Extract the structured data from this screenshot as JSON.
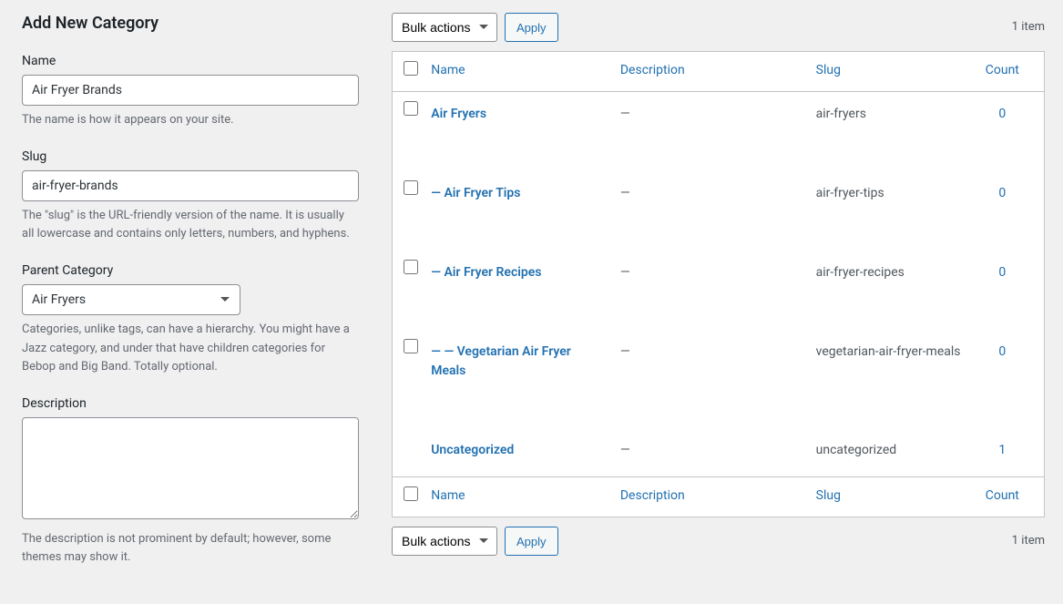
{
  "form": {
    "heading": "Add New Category",
    "name": {
      "label": "Name",
      "value": "Air Fryer Brands",
      "hint": "The name is how it appears on your site."
    },
    "slug": {
      "label": "Slug",
      "value": "air-fryer-brands",
      "hint": "The \"slug\" is the URL-friendly version of the name. It is usually all lowercase and contains only letters, numbers, and hyphens."
    },
    "parent": {
      "label": "Parent Category",
      "selected": "Air Fryers",
      "hint": "Categories, unlike tags, can have a hierarchy. You might have a Jazz category, and under that have children categories for Bebop and Big Band. Totally optional."
    },
    "description": {
      "label": "Description",
      "value": "",
      "hint": "The description is not prominent by default; however, some themes may show it."
    }
  },
  "tablenav": {
    "bulk_label": "Bulk actions",
    "apply_label": "Apply",
    "item_count": "1 item"
  },
  "table": {
    "headers": {
      "name": "Name",
      "description": "Description",
      "slug": "Slug",
      "count": "Count"
    },
    "rows": [
      {
        "name": "Air Fryers",
        "description": "—",
        "slug": "air-fryers",
        "count": "0"
      },
      {
        "name": "— Air Fryer Tips",
        "description": "—",
        "slug": "air-fryer-tips",
        "count": "0"
      },
      {
        "name": "— Air Fryer Recipes",
        "description": "—",
        "slug": "air-fryer-recipes",
        "count": "0"
      },
      {
        "name": "— — Vegetarian Air Fryer Meals",
        "description": "—",
        "slug": "vegetarian-air-fryer-meals",
        "count": "0"
      },
      {
        "name": "Uncategorized",
        "description": "—",
        "slug": "uncategorized",
        "count": "1"
      }
    ]
  }
}
